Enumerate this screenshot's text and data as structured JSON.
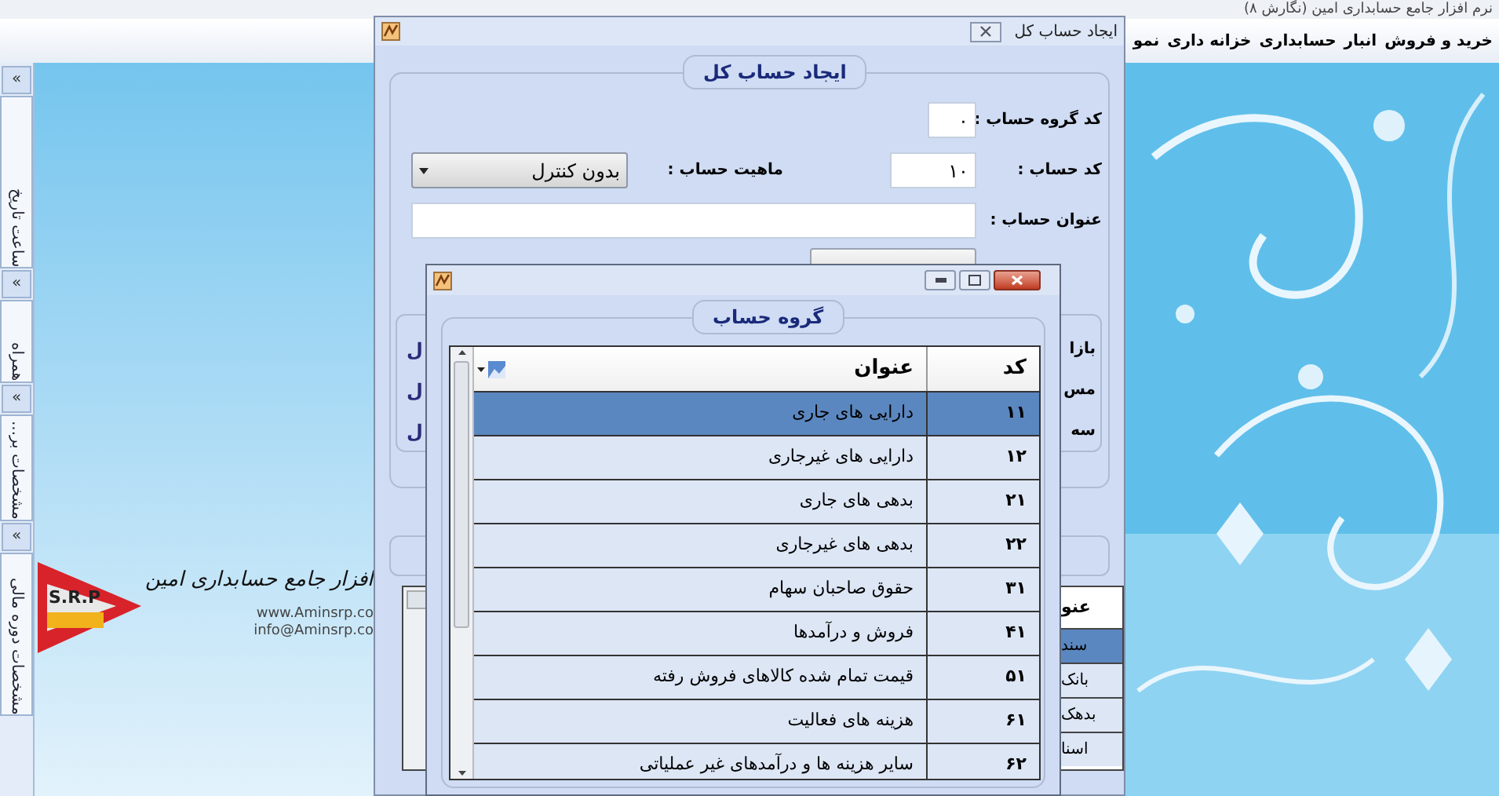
{
  "app_title": "نرم افزار جامع حسابداری امین (نگارش ۸)",
  "menu": [
    {
      "label": "خرید و فروش"
    },
    {
      "label": "انبار"
    },
    {
      "label": "حسابداری"
    },
    {
      "label": "خزانه داری"
    },
    {
      "label": "نمو"
    }
  ],
  "side_panels": [
    {
      "toggle": "«",
      "label": "ساعت تاریخ"
    },
    {
      "toggle": "«",
      "label": "همراه"
    },
    {
      "toggle": "«",
      "label": "مشخصات بر..."
    },
    {
      "toggle": "«",
      "label": "مشخصات دوره مالی"
    }
  ],
  "logo": {
    "badge": "S.R.P",
    "slogan": "افزار جامع حسابداری امین",
    "website": "www.Aminsrp.co",
    "email": "info@Aminsrp.co"
  },
  "account_window": {
    "title": "ایجاد حساب کل",
    "group_title": "ایجاد حساب کل",
    "group_code": {
      "label": "کد گروه حساب :",
      "value": "۰"
    },
    "account_code": {
      "label": "کد حساب :",
      "value": "۱۰"
    },
    "nature": {
      "label": "ماهیت حساب :",
      "value": "بدون کنترل"
    },
    "account_title": {
      "label": "عنوان حساب :"
    },
    "right_fragments": [
      "بازا",
      "مس",
      "سه"
    ],
    "left_fragments": [
      "ل",
      "ل",
      "ل"
    ],
    "grid": {
      "header": "عنو",
      "rows": [
        {
          "text": "سند",
          "selected": true
        },
        {
          "text": "بانک",
          "selected": false
        },
        {
          "text": "بدهک",
          "selected": false
        },
        {
          "text": "اسنا",
          "selected": false
        }
      ]
    }
  },
  "group_window": {
    "group_title": "گروه حساب",
    "columns": [
      "کد",
      "عنوان"
    ],
    "rows": [
      {
        "code": "۱۱",
        "title": "دارایی های جاری",
        "selected": true
      },
      {
        "code": "۱۲",
        "title": "دارایی های غیرجاری",
        "selected": false
      },
      {
        "code": "۲۱",
        "title": "بدهی های جاری",
        "selected": false
      },
      {
        "code": "۲۲",
        "title": "بدهی های غیرجاری",
        "selected": false
      },
      {
        "code": "۳۱",
        "title": "حقوق صاحبان سهام",
        "selected": false
      },
      {
        "code": "۴۱",
        "title": "فروش و درآمدها",
        "selected": false
      },
      {
        "code": "۵۱",
        "title": "قیمت تمام شده کالاهای فروش رفته",
        "selected": false
      },
      {
        "code": "۶۱",
        "title": "هزینه های فعالیت",
        "selected": false
      },
      {
        "code": "۶۲",
        "title": "سایر هزینه ها و درآمدهای غیر عملیاتی",
        "selected": false
      }
    ]
  }
}
